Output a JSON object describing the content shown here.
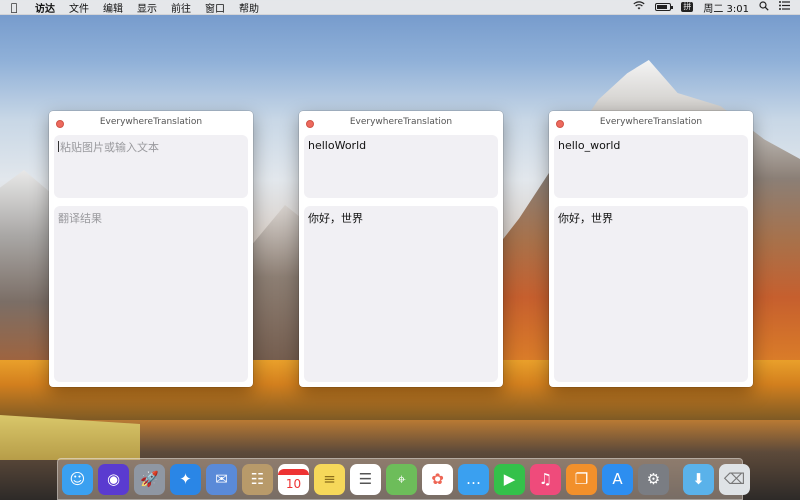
{
  "menubar": {
    "apple_icon": "apple-logo-icon",
    "items": [
      "访达",
      "文件",
      "编辑",
      "显示",
      "前往",
      "窗口",
      "帮助"
    ],
    "status": {
      "wifi_icon": "wifi-icon",
      "battery_level": 0.8,
      "input_method": "拼",
      "datetime": "周二 3:01",
      "search_icon": "spotlight-search-icon",
      "list_icon": "notification-center-icon"
    }
  },
  "windows": [
    {
      "title": "EverywhereTranslation",
      "input_placeholder": "粘贴图片或输入文本",
      "input_text": "",
      "output_placeholder": "翻译结果",
      "output_text": ""
    },
    {
      "title": "EverywhereTranslation",
      "input_placeholder": "",
      "input_text": "helloWorld",
      "output_placeholder": "",
      "output_text": "你好，世界"
    },
    {
      "title": "EverywhereTranslation",
      "input_placeholder": "",
      "input_text": "hello_world",
      "output_placeholder": "",
      "output_text": "你好，世界"
    }
  ],
  "dock": {
    "calendar_day": "10",
    "apps": [
      {
        "icon": "finder-icon",
        "color": "#3aa0f0"
      },
      {
        "icon": "siri-icon",
        "color": "#5a3bd0"
      },
      {
        "icon": "launchpad-icon",
        "color": "#8f97a3"
      },
      {
        "icon": "safari-icon",
        "color": "#2a86e6"
      },
      {
        "icon": "mail-photo-icon",
        "color": "#5a8ad8"
      },
      {
        "icon": "contacts-icon",
        "color": "#b89a6a"
      },
      {
        "icon": "calendar-icon",
        "color": "#ffffff"
      },
      {
        "icon": "notes-icon",
        "color": "#f6d85a"
      },
      {
        "icon": "reminders-icon",
        "color": "#ffffff"
      },
      {
        "icon": "maps-icon",
        "color": "#6dbd5a"
      },
      {
        "icon": "photos-icon",
        "color": "#ffffff"
      },
      {
        "icon": "messages-icon",
        "color": "#3aa0f0"
      },
      {
        "icon": "facetime-icon",
        "color": "#34c14a"
      },
      {
        "icon": "itunes-icon",
        "color": "#ef4b7b"
      },
      {
        "icon": "ibooks-icon",
        "color": "#f2902b"
      },
      {
        "icon": "app-store-icon",
        "color": "#2d8ef0"
      },
      {
        "icon": "system-preferences-icon",
        "color": "#7a7d83"
      },
      {
        "icon": "downloads-folder-icon",
        "color": "#5ab2ea"
      },
      {
        "icon": "trash-icon",
        "color": "#dfe3e6"
      }
    ]
  }
}
